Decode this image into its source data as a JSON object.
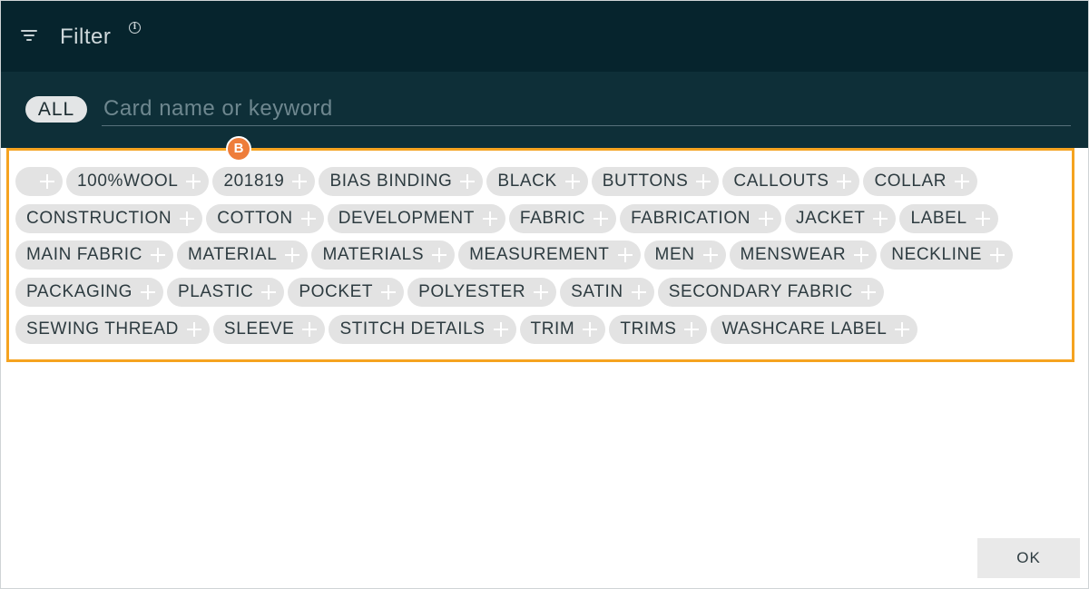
{
  "header": {
    "title": "Filter",
    "info_glyph": "i",
    "icon": "filter-icon"
  },
  "search": {
    "all_label": "ALL",
    "placeholder": "Card name or keyword",
    "value": ""
  },
  "badge": {
    "label": "B",
    "color": "#ee7d3b"
  },
  "tags_box": {
    "border_color": "#f5a320"
  },
  "tags": [
    "",
    "100%WOOL",
    "201819",
    "BIAS BINDING",
    "BLACK",
    "BUTTONS",
    "CALLOUTS",
    "COLLAR",
    "CONSTRUCTION",
    "COTTON",
    "DEVELOPMENT",
    "FABRIC",
    "FABRICATION",
    "JACKET",
    "LABEL",
    "MAIN FABRIC",
    "MATERIAL",
    "MATERIALS",
    "MEASUREMENT",
    "MEN",
    "MENSWEAR",
    "NECKLINE",
    "PACKAGING",
    "PLASTIC",
    "POCKET",
    "POLYESTER",
    "SATIN",
    "SECONDARY FABRIC",
    "SEWING THREAD",
    "SLEEVE",
    "STITCH DETAILS",
    "TRIM",
    "TRIMS",
    "WASHCARE LABEL"
  ],
  "footer": {
    "ok_label": "OK"
  }
}
